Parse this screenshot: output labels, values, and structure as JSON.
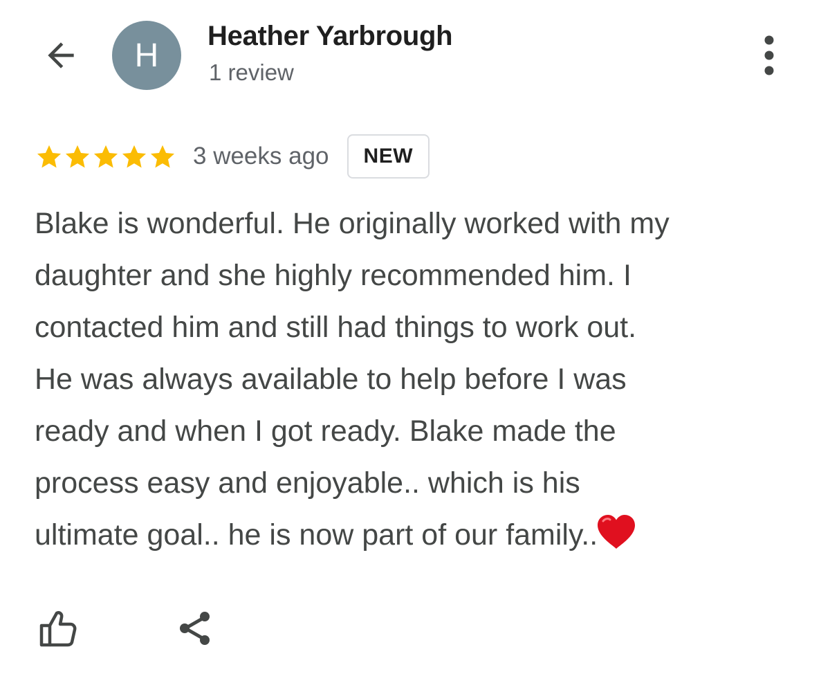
{
  "header": {
    "back_icon": "arrow-back-icon",
    "avatar_letter": "H",
    "avatar_color": "#78909c",
    "author_name": "Heather Yarbrough",
    "review_count": "1 review",
    "more_icon": "more-vert-icon"
  },
  "review": {
    "rating": 5,
    "rating_max": 5,
    "star_color": "#fbbc04",
    "timestamp": "3 weeks ago",
    "badge": "NEW",
    "text": "Blake is wonderful. He originally worked with my\ndaughter and she highly recommended him. I\ncontacted him and still had things to work out.\nHe was always available to help before I was\nready and when I got ready. Blake made the\nprocess easy and enjoyable.. which is his\nultimate goal.. he is now part of our family..",
    "emoji": "heart-emoji"
  },
  "actions": {
    "like_icon": "thumb-up-icon",
    "share_icon": "share-icon"
  }
}
